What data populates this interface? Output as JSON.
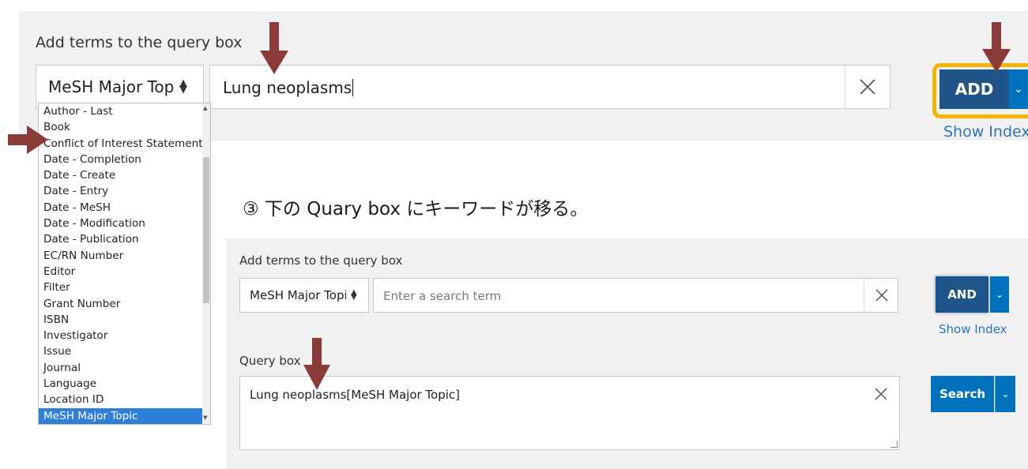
{
  "colors": {
    "panel_bg": "#f1f1f1",
    "primary_button": "#20558a",
    "secondary_button": "#0071bc",
    "link": "#2d74c0",
    "highlight_outline": "#f5b400",
    "annotation_arrow": "#8b3a3a",
    "selected_option_bg": "#2f7ed8"
  },
  "top_builder": {
    "heading": "Add terms to the query box",
    "field_select_value": "MeSH Major Topic",
    "term_value": "Lung neoplasms",
    "add_button_label": "ADD",
    "show_index_label": "Show Index"
  },
  "field_dropdown": {
    "options": [
      "Author - Last",
      "Book",
      "Conflict of Interest Statements",
      "Date - Completion",
      "Date - Create",
      "Date - Entry",
      "Date - MeSH",
      "Date - Modification",
      "Date - Publication",
      "EC/RN Number",
      "Editor",
      "Filter",
      "Grant Number",
      "ISBN",
      "Investigator",
      "Issue",
      "Journal",
      "Language",
      "Location ID",
      "MeSH Major Topic"
    ],
    "selected": "MeSH Major Topic"
  },
  "annotation": "③ 下の Quary box にキーワードが移る。",
  "bottom_builder": {
    "heading": "Add terms to the query box",
    "field_select_value": "MeSH Major Topic",
    "term_placeholder": "Enter a search term",
    "and_button_label": "AND",
    "show_index_label": "Show Index"
  },
  "query_box": {
    "label": "Query box",
    "value": "Lung neoplasms[MeSH Major Topic]",
    "search_button_label": "Search"
  },
  "icons": {
    "clear": "close-icon",
    "caret": "chevron-down-icon",
    "select_toggle": "sort-updown-icon",
    "annotation": "arrow-down-icon"
  }
}
